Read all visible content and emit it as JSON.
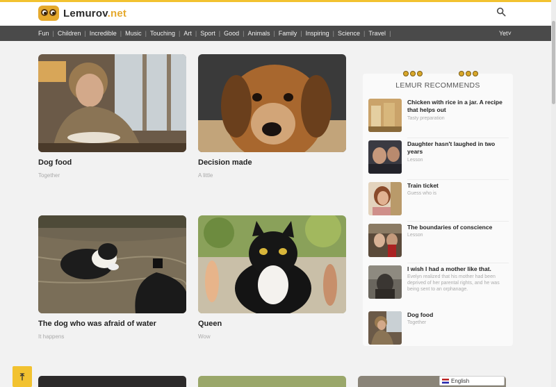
{
  "header": {
    "logo_name": "Lemurov",
    "logo_tld": ".net",
    "search_icon": "search-icon"
  },
  "nav": {
    "items": [
      "Fun",
      "Children",
      "Incredible",
      "Music",
      "Touching",
      "Art",
      "Sport",
      "Good",
      "Animals",
      "Family",
      "Inspiring",
      "Science",
      "Travel"
    ],
    "more_label": "Yet˅"
  },
  "cards": [
    {
      "title": "Dog food",
      "subtitle": "Together"
    },
    {
      "title": "Decision made",
      "subtitle": "A little"
    },
    {
      "title": "The dog who was afraid of water",
      "subtitle": "It happens"
    },
    {
      "title": "Queen",
      "subtitle": "Wow"
    }
  ],
  "sidebar": {
    "title": "LEMUR RECOMMENDS",
    "items": [
      {
        "title": "Chicken with rice in a jar. A recipe that helps out",
        "subtitle": "Tasty preparation"
      },
      {
        "title": "Daughter hasn't laughed in two years",
        "subtitle": "Lesson"
      },
      {
        "title": "Train ticket",
        "subtitle": "Guess who is"
      },
      {
        "title": "The boundaries of conscience",
        "subtitle": "Lesson"
      },
      {
        "title": "I wish I had a mother like that.",
        "subtitle": "Evelyn realized that his mother had been deprived of her parental rights, and he was being sent to an orphanage."
      },
      {
        "title": "Dog food",
        "subtitle": "Together"
      }
    ]
  },
  "footer": {
    "scroll_top_label": "⤒",
    "language": "English"
  },
  "colors": {
    "accent": "#f2c230",
    "nav_bg": "#4a4a4a"
  }
}
